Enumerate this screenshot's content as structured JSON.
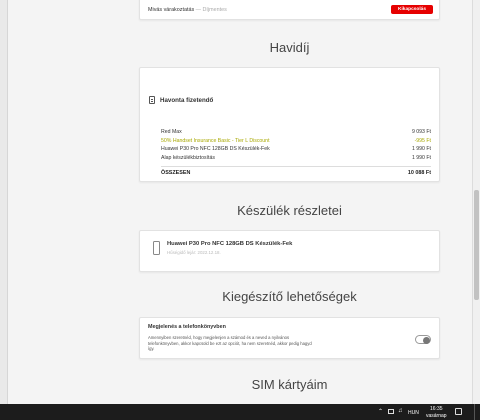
{
  "top_card": {
    "label": "Mivás várakoztatás",
    "status": "Díjmentes",
    "button": "Kikapcsolás"
  },
  "monthly": {
    "section_title": "Havidíj",
    "card_title": "Havonta fizetendő",
    "rows": [
      {
        "label": "Red Max",
        "value": "9 093 Ft",
        "promo": false
      },
      {
        "label": "50% Handset Insurance Basic - Tier L Discount",
        "value": "-995 Ft",
        "promo": true
      },
      {
        "label": "Huawei P30 Pro NFC 128GB DS Készülék-Fek",
        "value": "1 990 Ft",
        "promo": false
      },
      {
        "label": "Alap készülékbiztosítás",
        "value": "1 990 Ft",
        "promo": false
      }
    ],
    "total_label": "ÖSSZESEN",
    "total_value": "10 088 Ft"
  },
  "device": {
    "section_title": "Készülék részletei",
    "name": "Huawei P30 Pro NFC 128GB DS Készülék-Fek",
    "sub": "Hűségidő lejár: 2022.12.18."
  },
  "extras": {
    "section_title": "Kiegészítő lehetőségek",
    "title": "Megjelenés a telefonkönyvben",
    "description": "Amennyiben szeretnéd, hogy megjelenjen a számod és a neved a nyilvános telefonkönyvben, akkor kapcsold be ezt az opciót, ha nem szeretnéd, akkor pedig hagyd így.",
    "toggle_on": false
  },
  "sim": {
    "section_title": "SIM kártyáim"
  },
  "taskbar": {
    "lang": "HUN",
    "time": "16:35",
    "day": "vasárnap"
  },
  "colors": {
    "accent_red": "#e60000",
    "promo": "#a8a800"
  }
}
